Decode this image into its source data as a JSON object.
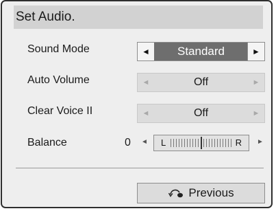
{
  "title": "Set Audio.",
  "rows": [
    {
      "label": "Sound Mode",
      "value": "Standard",
      "active": true
    },
    {
      "label": "Auto Volume",
      "value": "Off",
      "active": false
    },
    {
      "label": "Clear Voice II",
      "value": "Off",
      "active": false
    }
  ],
  "balance": {
    "label": "Balance",
    "value": "0",
    "left_letter": "L",
    "right_letter": "R"
  },
  "arrows": {
    "left": "◄",
    "right": "►"
  },
  "footer": {
    "previous_label": "Previous",
    "icon": "return-icon"
  }
}
